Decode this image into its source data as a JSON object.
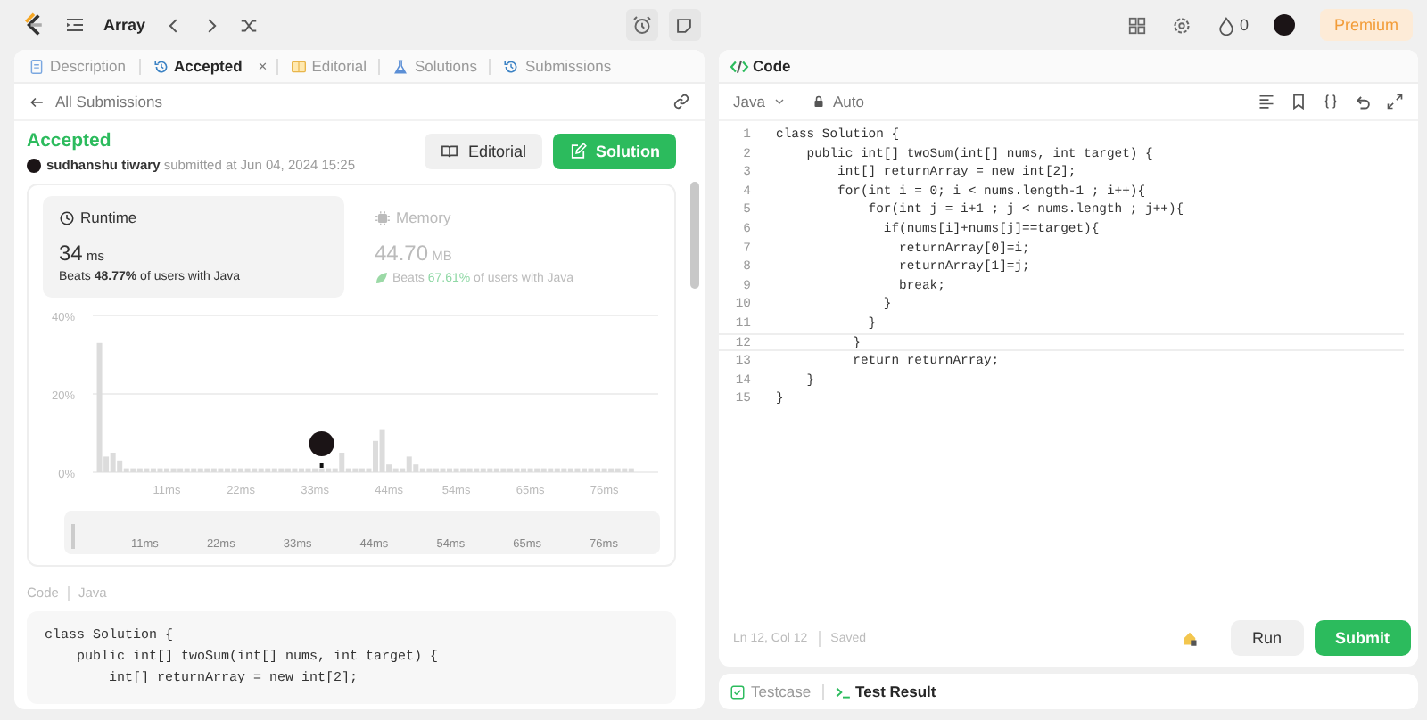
{
  "topbar": {
    "problem_list": "Array",
    "coins": "0",
    "premium": "Premium"
  },
  "left_tabs": [
    {
      "label": "Description",
      "selected": false,
      "closable": false,
      "kind": "doc"
    },
    {
      "label": "Accepted",
      "selected": true,
      "closable": true,
      "close": "×",
      "kind": "history"
    },
    {
      "label": "Editorial",
      "selected": false,
      "closable": false,
      "kind": "book"
    },
    {
      "label": "Solutions",
      "selected": false,
      "closable": false,
      "kind": "flask"
    },
    {
      "label": "Submissions",
      "selected": false,
      "closable": false,
      "kind": "history"
    }
  ],
  "back_link": "All Submissions",
  "submission": {
    "status": "Accepted",
    "user": "sudhanshu tiwary",
    "submitted": "submitted at Jun 04, 2024 15:25",
    "buttons": [
      {
        "label": "Editorial",
        "kind": "secondary"
      },
      {
        "label": "Solution",
        "kind": "primary"
      }
    ]
  },
  "stats": [
    {
      "kind": "clock",
      "title": "Runtime",
      "value": "34",
      "unit": "ms",
      "beats": "Beats **48.77%** of users with Java",
      "selected": true
    },
    {
      "kind": "chip",
      "title": "Memory",
      "value": "44.70",
      "unit": "MB",
      "beats": "Beats **67.61%** of users with Java",
      "selected": false
    }
  ],
  "chart_data": {
    "type": "bar",
    "x": [
      1,
      2,
      3,
      4,
      5,
      6,
      7,
      8,
      9,
      10,
      11,
      12,
      13,
      14,
      15,
      16,
      17,
      18,
      19,
      20,
      21,
      22,
      23,
      24,
      25,
      26,
      27,
      28,
      29,
      30,
      31,
      32,
      33,
      34,
      35,
      36,
      37,
      38,
      39,
      40,
      41,
      42,
      43,
      44,
      45,
      46,
      47,
      48,
      49,
      50,
      51,
      52,
      53,
      54,
      55,
      56,
      57,
      58,
      59,
      60,
      61,
      62,
      63,
      64,
      65,
      66,
      67,
      68,
      69,
      70,
      71,
      72,
      73,
      74,
      75,
      76,
      77,
      78,
      79,
      80
    ],
    "values": [
      33,
      4,
      5,
      3,
      1,
      1,
      1,
      1,
      1,
      1,
      1,
      1,
      1,
      1,
      1,
      1,
      1,
      1,
      1,
      1,
      1,
      1,
      1,
      1,
      1,
      1,
      1,
      1,
      1,
      1,
      1,
      1,
      1,
      1,
      1,
      1,
      5,
      1,
      1,
      1,
      1,
      8,
      11,
      2,
      1,
      1,
      4,
      2,
      1,
      1,
      1,
      1,
      1,
      1,
      1,
      1,
      1,
      1,
      1,
      1,
      1,
      1,
      1,
      1,
      1,
      1,
      1,
      1,
      1,
      1,
      1,
      1,
      1,
      1,
      1,
      1,
      1,
      1,
      1,
      1
    ],
    "xlim": [
      0,
      84
    ],
    "ylim": [
      0,
      40
    ],
    "xticks": [
      {
        "value": 11,
        "label": "11ms"
      },
      {
        "value": 22,
        "label": "22ms"
      },
      {
        "value": 33,
        "label": "33ms"
      },
      {
        "value": 44,
        "label": "44ms"
      },
      {
        "value": 54,
        "label": "54ms"
      },
      {
        "value": 65,
        "label": "65ms"
      },
      {
        "value": 76,
        "label": "76ms"
      }
    ],
    "yticks": [
      {
        "value": 0,
        "label": "0%"
      },
      {
        "value": 20,
        "label": "20%"
      },
      {
        "value": 40,
        "label": "40%"
      }
    ]
  },
  "range_labels": [
    "11ms",
    "22ms",
    "33ms",
    "44ms",
    "54ms",
    "65ms",
    "76ms"
  ],
  "code_preview": {
    "label": "Code",
    "language": "Java",
    "lines": [
      "class Solution {",
      "    public int[] twoSum(int[] nums, int target) {",
      "        int[] returnArray = new int[2];"
    ]
  },
  "editor": {
    "title": "Code",
    "language": "Java",
    "mode": "Auto",
    "lines": [
      {
        "number": "1",
        "text": "class Solution {",
        "current": false
      },
      {
        "number": "2",
        "text": "    public int[] twoSum(int[] nums, int target) {",
        "current": false
      },
      {
        "number": "3",
        "text": "        int[] returnArray = new int[2];",
        "current": false
      },
      {
        "number": "4",
        "text": "        for(int i = 0; i < nums.length-1 ; i++){",
        "current": false
      },
      {
        "number": "5",
        "text": "            for(int j = i+1 ; j < nums.length ; j++){",
        "current": false
      },
      {
        "number": "6",
        "text": "              if(nums[i]+nums[j]==target){",
        "current": false
      },
      {
        "number": "7",
        "text": "                returnArray[0]=i;",
        "current": false
      },
      {
        "number": "8",
        "text": "                returnArray[1]=j;",
        "current": false
      },
      {
        "number": "9",
        "text": "                break;",
        "current": false
      },
      {
        "number": "10",
        "text": "              }",
        "current": false
      },
      {
        "number": "11",
        "text": "            }",
        "current": false
      },
      {
        "number": "12",
        "text": "          }",
        "current": true
      },
      {
        "number": "13",
        "text": "          return returnArray;",
        "current": false
      },
      {
        "number": "14",
        "text": "    }",
        "current": false
      },
      {
        "number": "15",
        "text": "}",
        "current": false
      }
    ],
    "status": "Ln 12, Col 12",
    "saved": "Saved",
    "buttons": [
      {
        "label": "Run",
        "kind": "secondary"
      },
      {
        "label": "Submit",
        "kind": "primary"
      }
    ]
  },
  "bottom_tabs": [
    {
      "label": "Testcase",
      "selected": false,
      "kind": "check"
    },
    {
      "label": "Test Result",
      "selected": true,
      "kind": "terminal"
    }
  ]
}
